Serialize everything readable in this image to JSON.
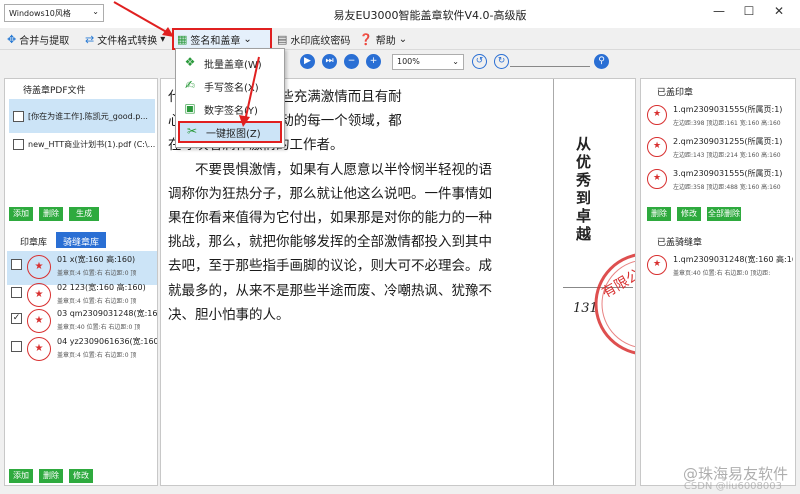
{
  "theme": "Windows10风格",
  "app_title": "易友EU3000智能盖章软件V4.0-高级版",
  "toolbar": {
    "merge": "合并与提取",
    "convert": "文件格式转换",
    "sign_seal": "签名和盖章",
    "watermark": "水印底纹密码",
    "help": "帮助"
  },
  "menu": {
    "batch": "批量盖章(W)",
    "handwrite": "手写签名(X)",
    "digital": "数字签名(Y)",
    "cutout": "一键抠图(Z)"
  },
  "left": {
    "pending_title": "待盖章PDF文件",
    "files": [
      "[你在为谁工作].陈凯元_good.p...",
      "new_HTT商业计划书(1).pdf (C:\\..."
    ],
    "add": "添加",
    "delete": "删除",
    "generate": "生成",
    "tab_seal": "印章库",
    "tab_riding": "骑缝章库",
    "seals": [
      {
        "name": "01 x(宽:160 高:160)",
        "info": "盖章页:4 位置:右 右边距:0 顶",
        "checked": false
      },
      {
        "name": "02 123(宽:160 高:160)",
        "info": "盖章页:4 位置:右 右边距:0 顶",
        "checked": false
      },
      {
        "name": "03 qm2309031248(宽:160 ...",
        "info": "盖章页:40 位置:右 右边距:0 顶",
        "checked": true
      },
      {
        "name": "04 yz2309061636(宽:160 ...",
        "info": "盖章页:4 位置:右 右边距:0 顶",
        "checked": false
      }
    ],
    "add2": "添加",
    "delete2": "删除",
    "modify": "修改"
  },
  "viewer": {
    "zoom": "100%"
  },
  "page": {
    "paragraphs": [
      "代 物，都等待着那些充满激情而且有耐",
      "心 行各业，人类活动的每一个领域，都",
      "在呼唤着满怀激情的工作者。",
      "不要畏惧激情，如果有人愿意以半怜悯半轻视的语",
      "调称你为狂热分子，那么就让他这么说吧。一件事情如",
      "果在你看来值得为它付出，如果那是对你的能力的一种",
      "挑战，那么，就把你能够发挥的全部激情都投入到其中",
      "去吧，至于那些指手画脚的议论，则大可不必理会。成",
      "就最多的，从来不是那些半途而废、冷嘲热讽、犹豫不",
      "决、胆小怕事的人。"
    ],
    "chapter": "从优秀到卓越",
    "page_number": "131",
    "stamp_text": "有限公司"
  },
  "right": {
    "stamped_title": "已盖印章",
    "stamped": [
      {
        "name": "1.qm2309031555(所属页:1)",
        "info": "左边距:398 顶边距:161 宽:160 高:160"
      },
      {
        "name": "2.qm2309031255(所属页:1)",
        "info": "左边距:143 顶边距:214 宽:160 高:160"
      },
      {
        "name": "3.qm2309031555(所属页:1)",
        "info": "左边距:358 顶边距:488 宽:160 高:160"
      }
    ],
    "delete": "删除",
    "modify": "修改",
    "delete_all": "全部删除",
    "riding_title": "已盖骑缝章",
    "riding": [
      {
        "name": "1.qm2309031248(宽:160 高:160)",
        "info": "盖章页:40 位置:右 右边距:0 顶边距:"
      }
    ]
  },
  "watermark": "@珠海易友软件",
  "watermark2": "CSDN @liu6008003"
}
